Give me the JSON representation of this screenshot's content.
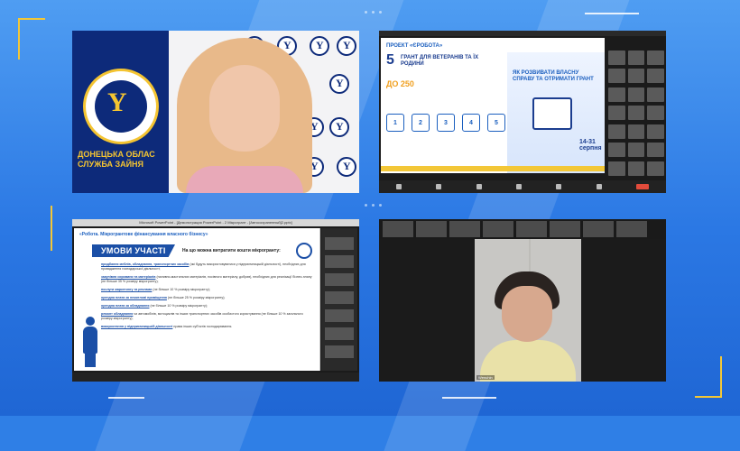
{
  "colors": {
    "background": "#2f7fe6",
    "accent": "#f3c737",
    "brand_blue": "#0d2a7a"
  },
  "panel1": {
    "logo_arc_text": "ДЕРЖАВНА СЛУЖБА ЗАЙНЯТОСТІ",
    "side_text": "ДОНЕЦЬКА ОБЛАС СЛУЖБА ЗАЙНЯ",
    "wall_label": "ДОНЕЦЬКА ОБЛАСНА СЛУЖБА ЗАЙНЯТОСТІ"
  },
  "panel2": {
    "header": "ПРОЕКТ «ЄРОБОТА»",
    "number": "5",
    "grant_text": "ГРАНТ ДЛЯ ВЕТЕРАНІВ ТА ЇХ РОДИНИ",
    "amount": "ДО 250",
    "steps": [
      "1",
      "2",
      "3",
      "4",
      "5"
    ],
    "right_title": "ЯК РОЗВИВАТИ ВЛАСНУ СПРАВУ ТА ОТРИМАТИ ГРАНТ",
    "dates": "14-31 серпня"
  },
  "panel3": {
    "window_title": "Microsoft PowerPoint - [Демонстрация PowerPoint - 2 Мікрогрант - [Автосохраненный]2.pptx]",
    "slide_header": "«Робота. Мікрогрантове фінансування власного бізнесу»",
    "banner": "УМОВИ УЧАСТІ",
    "question": "На що можна витратити кошти мікрогранту:",
    "items": [
      {
        "lead": "придбання меблів, обладнання, транспортних засобів",
        "rest": " (які будуть використовуватися у підприємницькій діяльності), необхідних для провадження господарської діяльності;"
      },
      {
        "lead": "закупівля сировини та матеріалів",
        "rest": " (паливно-мастильних матеріалів, посівного матеріалу, добрив), необхідних для реалізації бізнес-плану (не більше 35 % розміру мікрогранту);"
      },
      {
        "lead": "послуги маркетингу та реклами",
        "rest": " (не більше 10 % розміру мікрогранту);"
      },
      {
        "lead": "орендна плата за нежитлові приміщення",
        "rest": " (не більше 25 % розміру мікрогранту);"
      },
      {
        "lead": "орендна плата за обладнання",
        "rest": " (не більше 10 % розміру мікрогранту);"
      },
      {
        "lead": "ремонт обладнання",
        "rest": " чи автомобілів, мотоциклів та інших транспортних засобів особистого користування (не більше 10 % загального розміру мікрогранту);"
      },
      {
        "lead": "використання у підприємницькій діяльності",
        "rest": " права інших суб'єктів господарювання."
      }
    ]
  },
  "panel4": {
    "participant_name": "Wenuhin"
  }
}
